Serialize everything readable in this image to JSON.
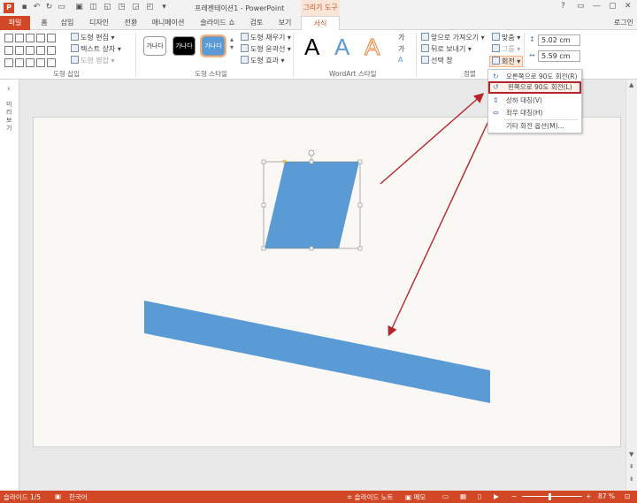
{
  "titlebar": {
    "app_icon": "P",
    "doc_title": "프레젠테이션1 - PowerPoint",
    "context_tab": "그리기 도구",
    "window_buttons": [
      "?",
      "▭",
      "—",
      "▢",
      "✕"
    ]
  },
  "tabs": {
    "file": "파일",
    "items": [
      "홈",
      "삽입",
      "디자인",
      "전환",
      "애니메이션",
      "슬라이드 쇼",
      "검토",
      "보기"
    ],
    "active": "서식",
    "login": "로그인"
  },
  "ribbon": {
    "insert_shapes": {
      "edit_shape": "도형 편집 ▾",
      "text_box": "텍스트 상자 ▾",
      "merge_shapes": "도형 병합 ▾",
      "label": "도형 삽입"
    },
    "shape_styles": {
      "style_samples": [
        "가나다",
        "가나다",
        "가나다"
      ],
      "fill": "도형 채우기 ▾",
      "outline": "도형 윤곽선 ▾",
      "effects": "도형 효과 ▾",
      "label": "도형 스타일"
    },
    "wordart": {
      "letters": [
        "A",
        "A",
        "A"
      ],
      "label": "WordArt 스타일"
    },
    "arrange": {
      "bring_forward": "앞으로 가져오기 ▾",
      "send_backward": "뒤로 보내기 ▾",
      "selection_pane": "선택 창",
      "align": "맞춤 ▾",
      "group": "그룹 ▾",
      "rotate": "회전 ▾",
      "label": "정렬"
    },
    "size": {
      "height": "5.02 cm",
      "width": "5.59 cm"
    }
  },
  "rotate_menu": {
    "items": [
      {
        "label": "오른쪽으로 90도 회전(R)",
        "icon": "rotate-right-icon"
      },
      {
        "label": "왼쪽으로 90도 회전(L)",
        "icon": "rotate-left-icon"
      },
      {
        "label": "상하 대칭(V)",
        "icon": "flip-vertical-icon"
      },
      {
        "label": "좌우 대칭(H)",
        "icon": "flip-horizontal-icon"
      },
      {
        "label": "기타 회전 옵션(M)...",
        "icon": ""
      }
    ],
    "highlighted_index": 1
  },
  "left_pane": {
    "label": "미리보기"
  },
  "statusbar": {
    "slide_info": "슬라이드 1/5",
    "language": "한국어",
    "notes": "≐ 슬라이드 노트",
    "comments": "▣ 메모",
    "zoom": "87 %"
  },
  "colors": {
    "accent": "#d24726",
    "shape_fill": "#5b9bd5",
    "annotation": "#b3262c"
  }
}
